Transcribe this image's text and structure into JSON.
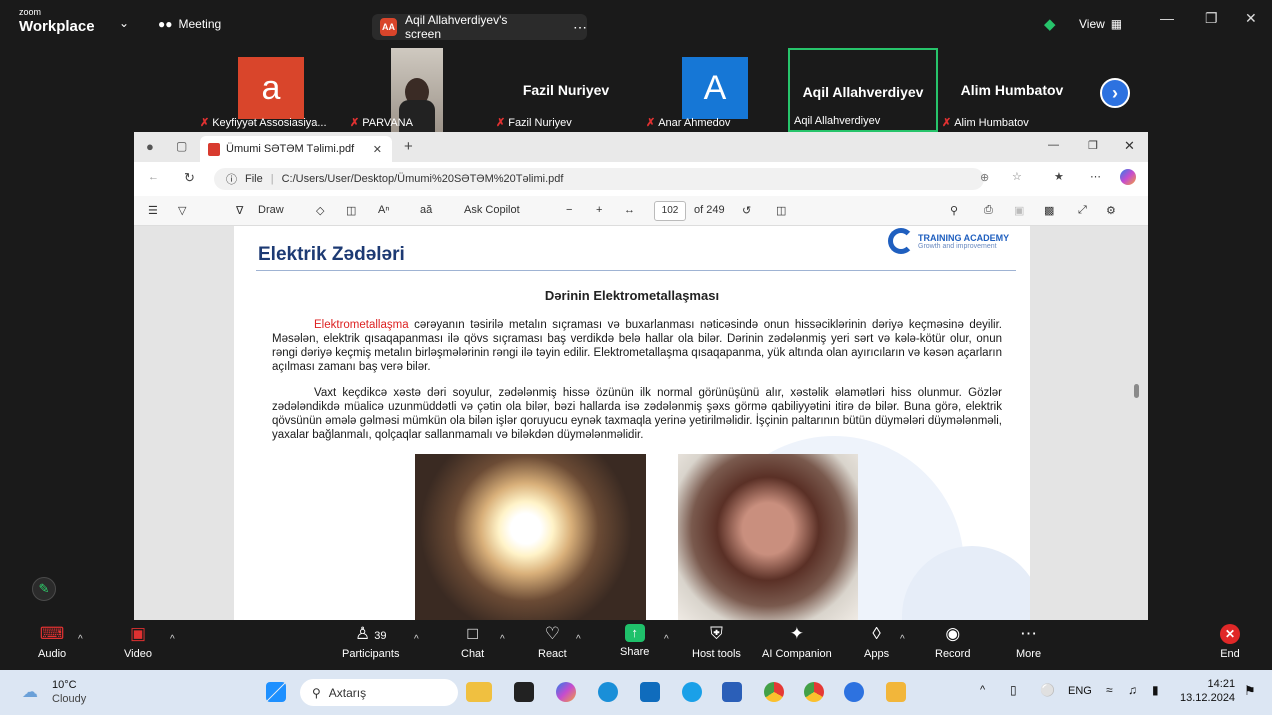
{
  "topbar": {
    "brand_small": "zoom",
    "brand_big": "Workplace",
    "meeting": "Meeting",
    "screen_initials": "AA",
    "screen_label": "Aqil Allahverdiyev's screen",
    "view": "View"
  },
  "participants": [
    {
      "avatar": "a",
      "name": "Keyfiyyət Assosiasiya...",
      "color": "#d9452b"
    },
    {
      "avatar": "",
      "name": "PARVANA",
      "color": ""
    },
    {
      "bigname": "Fazil Nuriyev",
      "name": "Fazil Nuriyev"
    },
    {
      "avatar": "A",
      "name": "Anar Ahmedov",
      "color": "#1677d6"
    },
    {
      "bigname": "Aqil Allahverdiyev",
      "name": "Aqil Allahverdiyev"
    },
    {
      "bigname": "Alim Humbatov",
      "name": "Alim Humbatov"
    }
  ],
  "browser": {
    "tab_title": "Ümumi SƏTƏM Təlimi.pdf",
    "file_label": "File",
    "url": "C:/Users/User/Desktop/Ümumi%20SƏTƏM%20Təlimi.pdf",
    "draw": "Draw",
    "ask_copilot": "Ask Copilot",
    "page_num": "102",
    "page_total": "of 249"
  },
  "pdf": {
    "logo_title": "TRAINING ACADEMY",
    "logo_sub": "Growth and improvement",
    "title": "Elektrik Zədələri",
    "subtitle": "Dərinin Elektrometallaşması",
    "p1_red": "Elektrometallaşma",
    "p1_rest": " cərəyanın təsirilə metalın sıçraması və buxarlanması nəticəsində onun hissəciklərinin dəriyə keçməsinə deyilir. Məsələn, elektrik qısaqapanması ilə qövs sıçraması baş verdikdə belə hallar ola bilər. Dərinin zədələnmiş yeri sərt və kələ-kötür olur, onun rəngi dəriyə keçmiş metalın birləşmələrinin rəngi ilə təyin edilir. Elektrometallaşma qısaqapanma, yük altında olan ayırıcıların və kəsən açarların açılması zamanı baş verə bilər.",
    "p2": "Vaxt keçdikcə xəstə dəri soyulur, zədələnmiş hissə özünün ilk normal görünüşünü alır, xəstəlik əlamətləri hiss olunmur. Gözlər zədələndikdə müalicə uzunmüddətli və çətin ola bilər, bəzi hallarda isə zədələnmiş şəxs görmə qabiliyyətini itirə də bilər. Buna görə, elektrik qövsünün əmələ gəlməsi mümkün ola bilən işlər qoruyucu eynək taxmaqla yerinə yetirilməlidir. İşçinin paltarının bütün düymələri düymələnməli, yaxalar bağlanmalı, qolçaqlar sallanmamalı və biləkdən düymələnməlidir."
  },
  "controls": {
    "audio": "Audio",
    "video": "Video",
    "participants": "Participants",
    "participants_count": "39",
    "chat": "Chat",
    "react": "React",
    "share": "Share",
    "host_tools": "Host tools",
    "ai_companion": "AI Companion",
    "apps": "Apps",
    "record": "Record",
    "more": "More",
    "end": "End"
  },
  "taskbar": {
    "temp": "10°C",
    "weather": "Cloudy",
    "search": "Axtarış",
    "lang": "ENG",
    "time": "14:21",
    "date": "13.12.2024"
  },
  "colors": {
    "zoom_green": "#27c46b",
    "accent_blue": "#2d72e0",
    "end_red": "#e02828"
  }
}
